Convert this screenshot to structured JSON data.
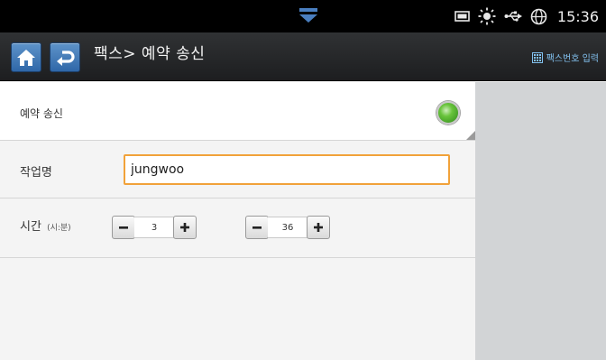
{
  "status_bar": {
    "time": "15:36",
    "icons": [
      "notification-chevron-icon",
      "storage-icon",
      "brightness-icon",
      "usb-icon",
      "globe-icon"
    ]
  },
  "header": {
    "title": "팩스> 예약 송신",
    "fax_number_button_label": "팩스번호 입력",
    "icons": [
      "home-icon",
      "back-icon",
      "keypad-icon"
    ]
  },
  "schedule_row": {
    "label": "예약 송신",
    "enabled": true
  },
  "job_row": {
    "label": "작업명",
    "value": "jungwoo"
  },
  "time_row": {
    "label": "시간",
    "unit": "(시:분)",
    "hour": "3",
    "minute": "36"
  },
  "colors": {
    "accent_blue": "#3a73b3",
    "input_focus": "#f1a23a",
    "toggle_on": "#5bbf30",
    "link": "#82c0ee"
  }
}
